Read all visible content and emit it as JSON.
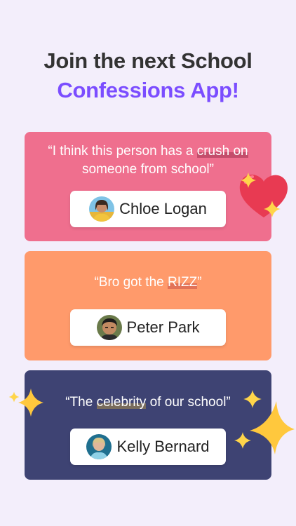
{
  "headline": {
    "line1": "Join the next School",
    "line2": "Confessions App!"
  },
  "cards": [
    {
      "quote_part1": "“I think this person has a ",
      "quote_highlight": "crush on",
      "quote_part2": " someone from school”",
      "name": "Chloe Logan",
      "avatar_icon": "avatar-chloe"
    },
    {
      "quote_part1": "“Bro got the ",
      "quote_highlight": "RIZZ",
      "quote_part2": "”",
      "name": "Peter Park",
      "avatar_icon": "avatar-peter"
    },
    {
      "quote_part1": "“The ",
      "quote_highlight": "celebrity",
      "quote_part2": " of our school”",
      "name": "Kelly Bernard",
      "avatar_icon": "avatar-kelly"
    }
  ],
  "colors": {
    "background": "#f3eefb",
    "headline_dark": "#333333",
    "headline_accent": "#7b4dff",
    "card_pink": "#ef6f8e",
    "card_orange": "#ff9a6b",
    "card_navy": "#3e4373",
    "heart": "#e83a52",
    "star": "#ffc83d"
  }
}
